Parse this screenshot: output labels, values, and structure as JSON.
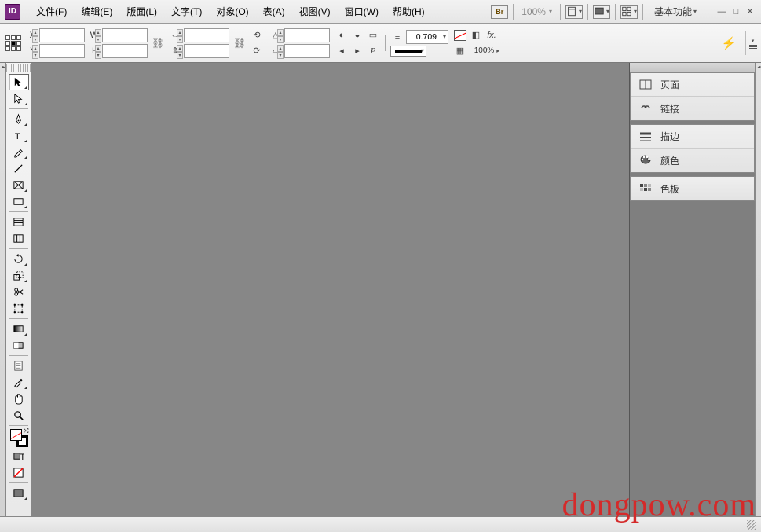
{
  "app": {
    "badge": "ID"
  },
  "menu": {
    "file": "文件(F)",
    "edit": "编辑(E)",
    "layout": "版面(L)",
    "type": "文字(T)",
    "object": "对象(O)",
    "table": "表(A)",
    "view": "视图(V)",
    "window": "窗口(W)",
    "help": "帮助(H)"
  },
  "topbar": {
    "bridge_label": "Br",
    "zoom": "100%",
    "workspace": "基本功能"
  },
  "control": {
    "x_label": "X:",
    "y_label": "Y:",
    "w_label": "W:",
    "h_label": "H:",
    "x": "",
    "y": "",
    "w": "",
    "h": "",
    "stroke_weight": "0.709",
    "opacity": "100%",
    "fx_label": "fx."
  },
  "panels": {
    "pages": "页面",
    "links": "链接",
    "stroke": "描边",
    "color": "颜色",
    "swatches": "色板"
  },
  "watermark": "dongpow.com"
}
